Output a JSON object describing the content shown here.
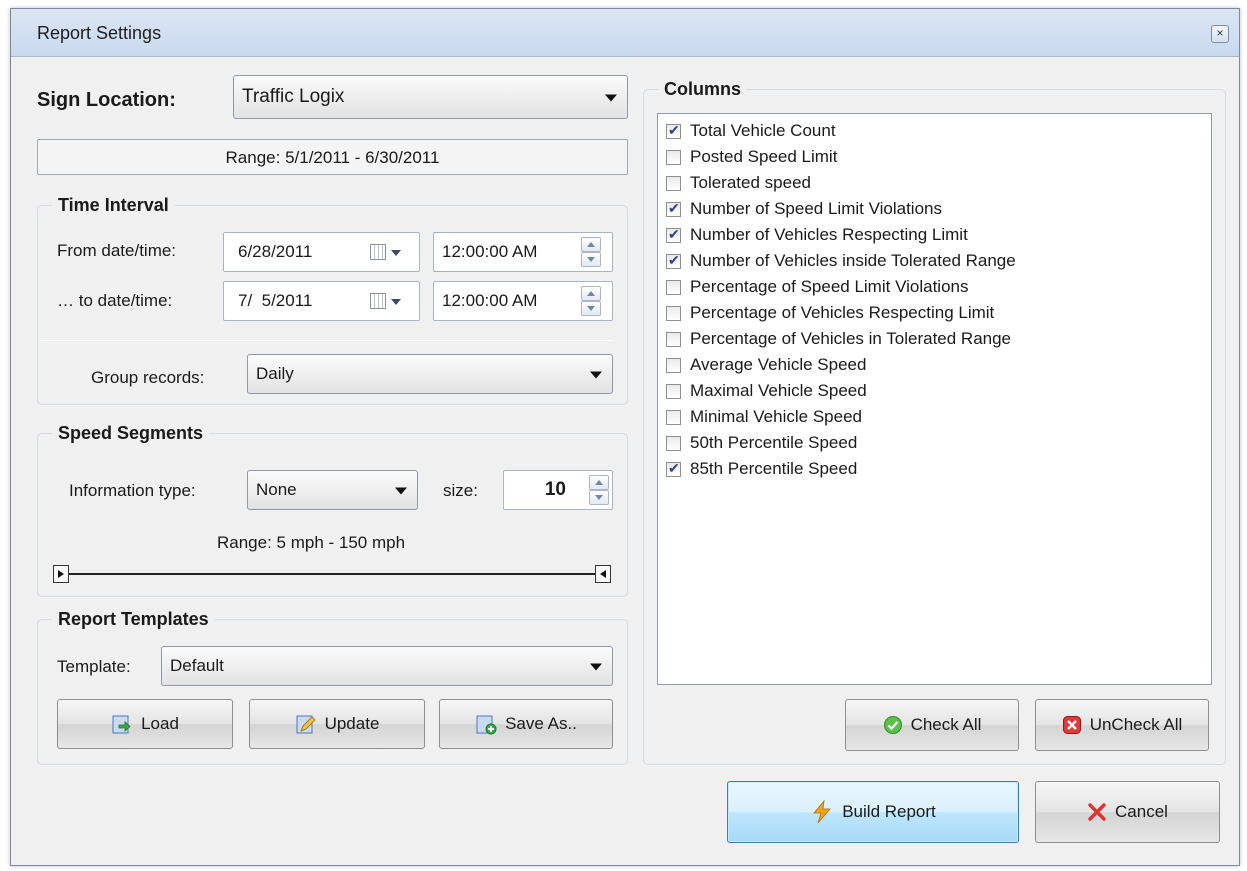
{
  "window": {
    "title": "Report Settings",
    "close_glyph": "×"
  },
  "sign_location": {
    "label": "Sign Location:",
    "value": "Traffic Logix",
    "range_text": "Range: 5/1/2011 - 6/30/2011"
  },
  "time_interval": {
    "title": "Time Interval",
    "from_label": "From date/time:",
    "from_date": "6/28/2011",
    "from_time": "12:00:00 AM",
    "to_label": "… to date/time:",
    "to_date": "7/  5/2011",
    "to_time": "12:00:00 AM",
    "group_label": "Group records:",
    "group_value": "Daily"
  },
  "speed_segments": {
    "title": "Speed Segments",
    "info_label": "Information type:",
    "info_value": "None",
    "size_label": "size:",
    "size_value": "10",
    "range_text": "Range: 5 mph - 150 mph",
    "slider_low_fraction": 0.0,
    "slider_high_fraction": 1.0
  },
  "report_templates": {
    "title": "Report Templates",
    "template_label": "Template:",
    "template_value": "Default",
    "load_label": "Load",
    "update_label": "Update",
    "save_as_label": "Save As.."
  },
  "columns": {
    "title": "Columns",
    "items": [
      {
        "label": "Total Vehicle Count",
        "checked": true
      },
      {
        "label": "Posted Speed Limit",
        "checked": false
      },
      {
        "label": "Tolerated speed",
        "checked": false
      },
      {
        "label": "Number of Speed Limit Violations",
        "checked": true
      },
      {
        "label": "Number of Vehicles Respecting Limit",
        "checked": true
      },
      {
        "label": "Number of Vehicles inside Tolerated Range",
        "checked": true
      },
      {
        "label": "Percentage of Speed Limit Violations",
        "checked": false
      },
      {
        "label": "Percentage of Vehicles Respecting Limit",
        "checked": false
      },
      {
        "label": "Percentage of Vehicles in Tolerated Range",
        "checked": false
      },
      {
        "label": "Average Vehicle Speed",
        "checked": false
      },
      {
        "label": "Maximal Vehicle Speed",
        "checked": false
      },
      {
        "label": "Minimal Vehicle Speed",
        "checked": false
      },
      {
        "label": "50th Percentile Speed",
        "checked": false
      },
      {
        "label": "85th Percentile Speed",
        "checked": true
      }
    ],
    "check_all_label": "Check All",
    "uncheck_all_label": "UnCheck All"
  },
  "footer": {
    "build_label": "Build Report",
    "cancel_label": "Cancel"
  },
  "colors": {
    "accent": "#3c7fb1",
    "check_green": "#3aa832",
    "uncheck_red": "#d12a2a",
    "bolt_orange": "#f2a21a"
  }
}
